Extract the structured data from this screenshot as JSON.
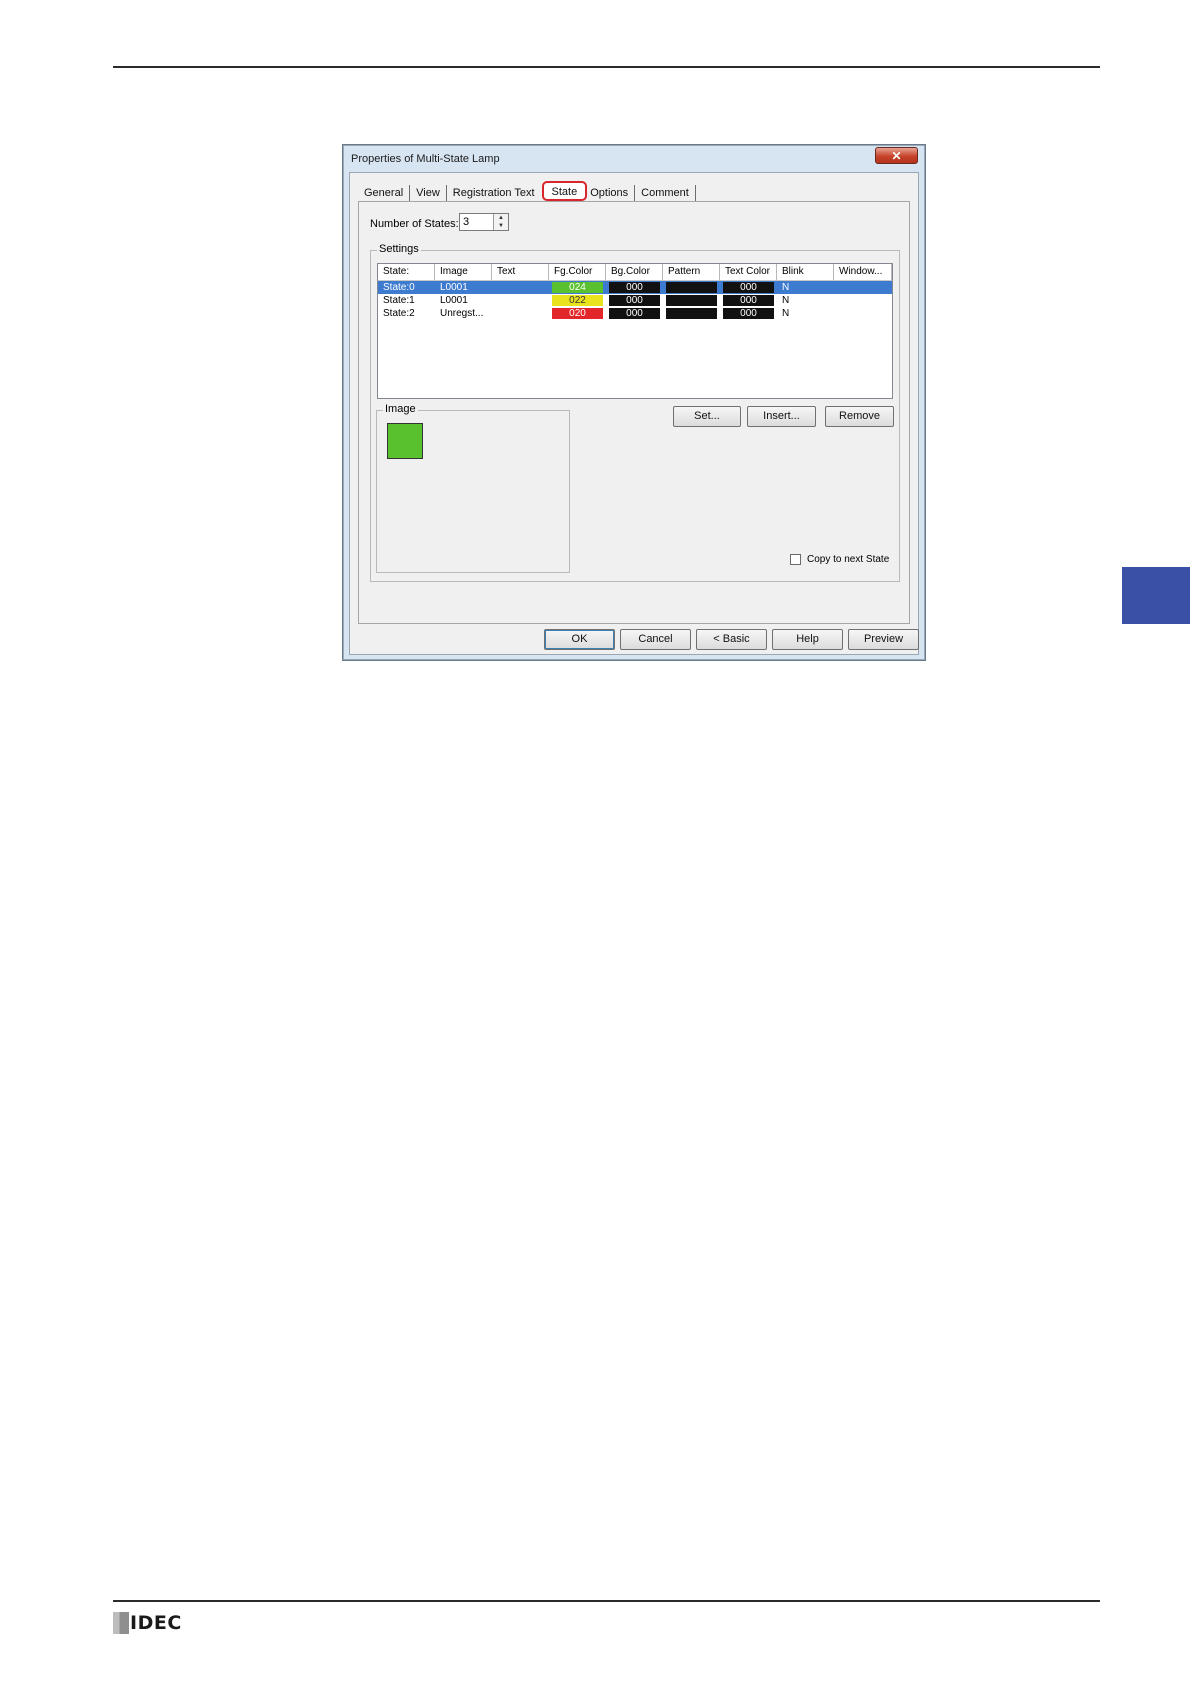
{
  "dialog": {
    "title": "Properties of Multi-State Lamp",
    "close_glyph": "✕",
    "tabs": [
      "General",
      "View",
      "Registration Text",
      "State",
      "Options",
      "Comment"
    ],
    "active_tab": "State",
    "number_of_states_label": "Number of States:",
    "number_of_states_value": "3",
    "settings_label": "Settings",
    "columns": [
      "State:",
      "Image",
      "Text",
      "Fg.Color",
      "Bg.Color",
      "Pattern",
      "Text Color",
      "Blink",
      "Window..."
    ],
    "rows": [
      {
        "state": "State:0",
        "image": "L0001",
        "text": "",
        "fg": "024",
        "fg_color": "#5ac12e",
        "bg": "000",
        "pattern": "",
        "text_color": "000",
        "blink": "N",
        "window": "",
        "selected": true
      },
      {
        "state": "State:1",
        "image": "L0001",
        "text": "",
        "fg": "022",
        "fg_color": "#e9e31e",
        "bg": "000",
        "pattern": "",
        "text_color": "000",
        "blink": "N",
        "window": "",
        "selected": false
      },
      {
        "state": "State:2",
        "image": "Unregst...",
        "text": "",
        "fg": "020",
        "fg_color": "#e3262a",
        "bg": "000",
        "pattern": "",
        "text_color": "000",
        "blink": "N",
        "window": "",
        "selected": false
      }
    ],
    "image_group_label": "Image",
    "image_preview_color": "#5ac12e",
    "buttons": {
      "set": "Set...",
      "insert": "Insert...",
      "remove": "Remove"
    },
    "copy_to_next_label": "Copy to next State",
    "footer_buttons": {
      "ok": "OK",
      "cancel": "Cancel",
      "basic": "< Basic",
      "help": "Help",
      "preview": "Preview"
    }
  },
  "brand": {
    "logo_text": "IDEC",
    "section_tab_color": "#3a4fa6"
  }
}
